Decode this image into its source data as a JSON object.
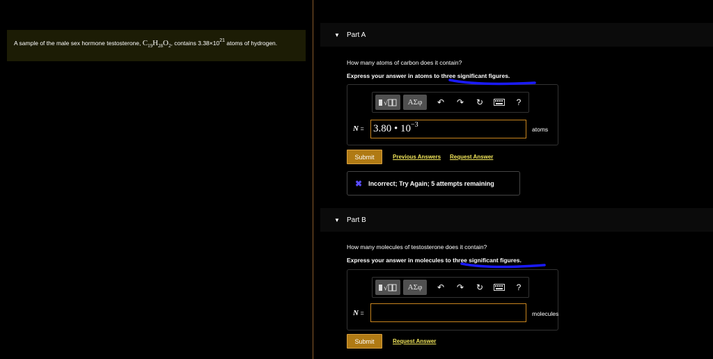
{
  "problem": {
    "text_before": "A sample of the male sex hormone testosterone, ",
    "formula_c": "C",
    "formula_c_sub": "19",
    "formula_h": "H",
    "formula_h_sub": "28",
    "formula_o": "O",
    "formula_o_sub": "2",
    "text_middle": ", contains 3.38×10",
    "exponent": "21",
    "text_after": " atoms of hydrogen."
  },
  "partA": {
    "title": "Part A",
    "question": "How many atoms of carbon does it contain?",
    "instruction": "Express your answer in atoms to three significant figures.",
    "variable": "N",
    "equals": " =",
    "answer_mantissa": "3.80 • 10",
    "answer_exponent": "−3",
    "unit": "atoms",
    "submit_label": "Submit",
    "previous_answers_label": "Previous Answers",
    "request_answer_label": "Request Answer",
    "feedback_icon": "✖",
    "feedback_text": "Incorrect; Try Again; 5 attempts remaining"
  },
  "partB": {
    "title": "Part B",
    "question": "How many molecules of testosterone does it contain?",
    "instruction": "Express your answer in molecules to three significant figures.",
    "variable": "N",
    "equals": " =",
    "answer_value": "",
    "unit": "molecules",
    "submit_label": "Submit",
    "request_answer_label": "Request Answer"
  },
  "toolbar": {
    "greek_label": "ΑΣφ",
    "help_label": "?",
    "icons": [
      "templates-icon",
      "greek-symbols-icon",
      "undo-icon",
      "redo-icon",
      "reset-icon",
      "keyboard-icon",
      "help-icon"
    ]
  },
  "colors": {
    "accent_submit": "#b07a14",
    "link": "#f1e55a",
    "input_border": "#c8841e",
    "scribble": "#1a1aff",
    "problem_bg": "#1c1c05",
    "feedback_x": "#5a4dff"
  }
}
